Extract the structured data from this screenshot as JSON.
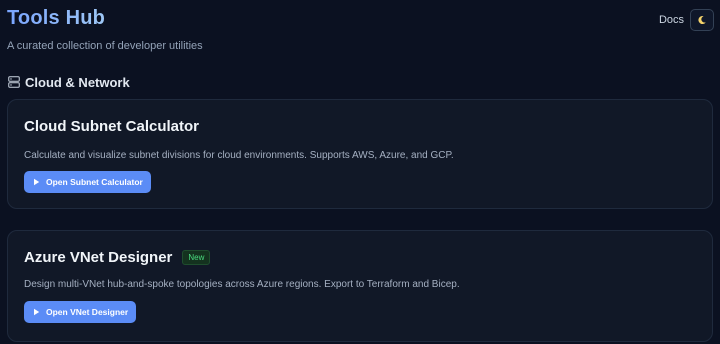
{
  "header": {
    "title": "Tools Hub",
    "subtitle": "A curated collection of developer utilities",
    "docs_label": "Docs",
    "theme_icon": "moon-icon"
  },
  "section": {
    "title": "Cloud & Network",
    "icon": "server-icon"
  },
  "cards": [
    {
      "title": "Cloud Subnet Calculator",
      "description": "Calculate and visualize subnet divisions for cloud environments. Supports AWS, Azure, and GCP.",
      "button_label": "Open Subnet Calculator",
      "button_icon": "play-icon"
    },
    {
      "title": "Azure VNet Designer",
      "badge": "New",
      "description": "Design multi-VNet hub-and-spoke topologies across Azure regions. Export to Terraform and Bicep.",
      "button_label": "Open VNet Designer",
      "button_icon": "play-icon"
    }
  ],
  "colors": {
    "background": "#0b1121",
    "card_background": "#111827",
    "accent": "#5b8cf6",
    "title_gradient_start": "#7aa5ff",
    "badge_green": "#4ade80"
  }
}
